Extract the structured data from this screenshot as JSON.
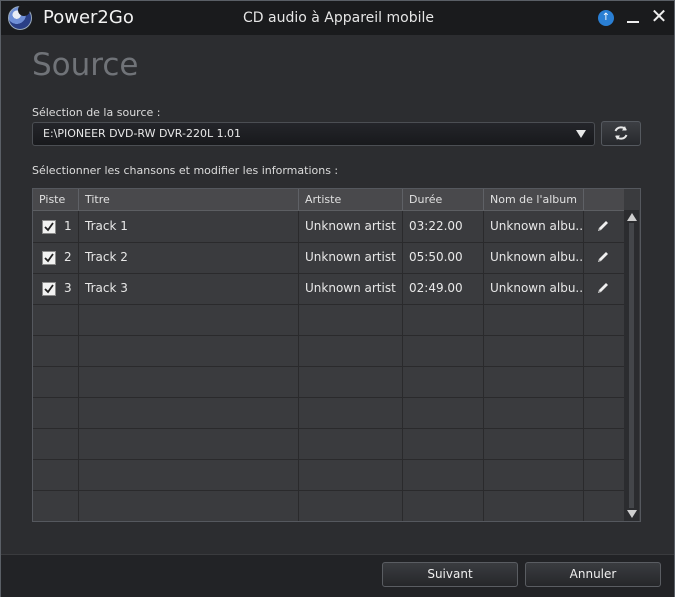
{
  "titlebar": {
    "app_name": "Power2Go",
    "window_title": "CD audio à Appareil mobile",
    "icons": [
      "power2go-logo-icon",
      "update-arrow-icon",
      "minimize-icon",
      "close-icon"
    ]
  },
  "page": {
    "heading": "Source",
    "source_label": "Sélection de la source :",
    "source_value": "E:\\PIONEER DVD-RW DVR-220L 1.01",
    "songs_label": "Sélectionner les chansons et modifier les informations :"
  },
  "table": {
    "headers": [
      "Piste",
      "Titre",
      "Artiste",
      "Durée",
      "Nom de l'album",
      ""
    ],
    "rows": [
      {
        "checked": true,
        "num": "1",
        "title": "Track 1",
        "artist": "Unknown artist",
        "duration": "03:22.00",
        "album": "Unknown albu..."
      },
      {
        "checked": true,
        "num": "2",
        "title": "Track 2",
        "artist": "Unknown artist",
        "duration": "05:50.00",
        "album": "Unknown albu..."
      },
      {
        "checked": true,
        "num": "3",
        "title": "Track 3",
        "artist": "Unknown artist",
        "duration": "02:49.00",
        "album": "Unknown albu..."
      }
    ]
  },
  "footer": {
    "next_label": "Suivant",
    "cancel_label": "Annuler"
  },
  "colors": {
    "background": "#2c2d30",
    "titlebar": "#1a1b1d",
    "accent": "#2a7fd4"
  }
}
